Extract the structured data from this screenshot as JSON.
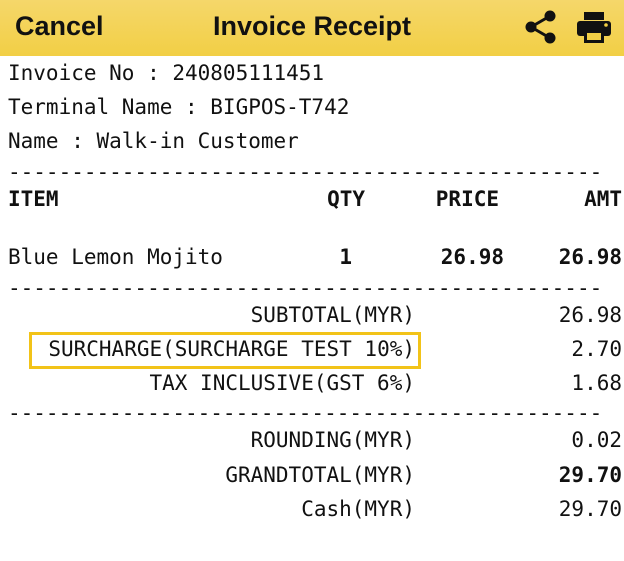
{
  "header": {
    "cancel_label": "Cancel",
    "title": "Invoice Receipt",
    "share_icon": "share-icon",
    "print_icon": "printer-icon",
    "bg_color": "#f2cf45"
  },
  "info": {
    "invoice_no": "Invoice No : 240805111451",
    "terminal_name": "Terminal Name : BIGPOS-T742",
    "name": "Name : Walk-in Customer"
  },
  "separator": "-----------------------------------------------",
  "columns": {
    "item": "ITEM",
    "qty": "QTY",
    "price": "PRICE",
    "amt": "AMT"
  },
  "items": [
    {
      "name": "Blue Lemon Mojito",
      "qty": "1",
      "price": "26.98",
      "amt": "26.98"
    }
  ],
  "summary": [
    {
      "label": "SUBTOTAL(MYR)",
      "value": "26.98"
    },
    {
      "label": "SURCHARGE(SURCHARGE TEST 10%)",
      "value": "2.70"
    },
    {
      "label": "TAX INCLUSIVE(GST 6%)",
      "value": "1.68"
    }
  ],
  "totals": [
    {
      "label": "ROUNDING(MYR)",
      "value": "0.02"
    },
    {
      "label": "GRANDTOTAL(MYR)",
      "value": "29.70"
    },
    {
      "label": "Cash(MYR)",
      "value": "29.70"
    }
  ],
  "highlight_color": "#f2c318"
}
